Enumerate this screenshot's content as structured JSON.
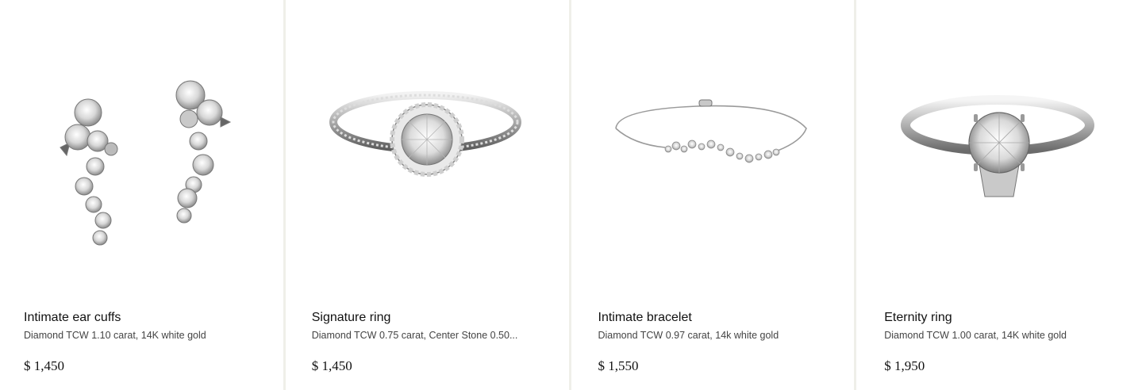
{
  "products": [
    {
      "name": "Intimate ear cuffs",
      "description": "Diamond TCW 1.10 carat, 14K white gold",
      "price": "$ 1,450",
      "image": "ear-cuffs-image"
    },
    {
      "name": "Signature ring",
      "description": "Diamond TCW 0.75 carat, Center Stone 0.50...",
      "price": "$ 1,450",
      "image": "halo-ring-image"
    },
    {
      "name": "Intimate bracelet",
      "description": "Diamond TCW 0.97 carat, 14k white gold",
      "price": "$ 1,550",
      "image": "bracelet-image"
    },
    {
      "name": "Eternity ring",
      "description": "Diamond TCW 1.00 carat, 14K white gold",
      "price": "$ 1,950",
      "image": "solitaire-ring-image"
    }
  ],
  "colors": {
    "divider": "#efefe9",
    "text": "#111111",
    "muted": "#444444"
  }
}
